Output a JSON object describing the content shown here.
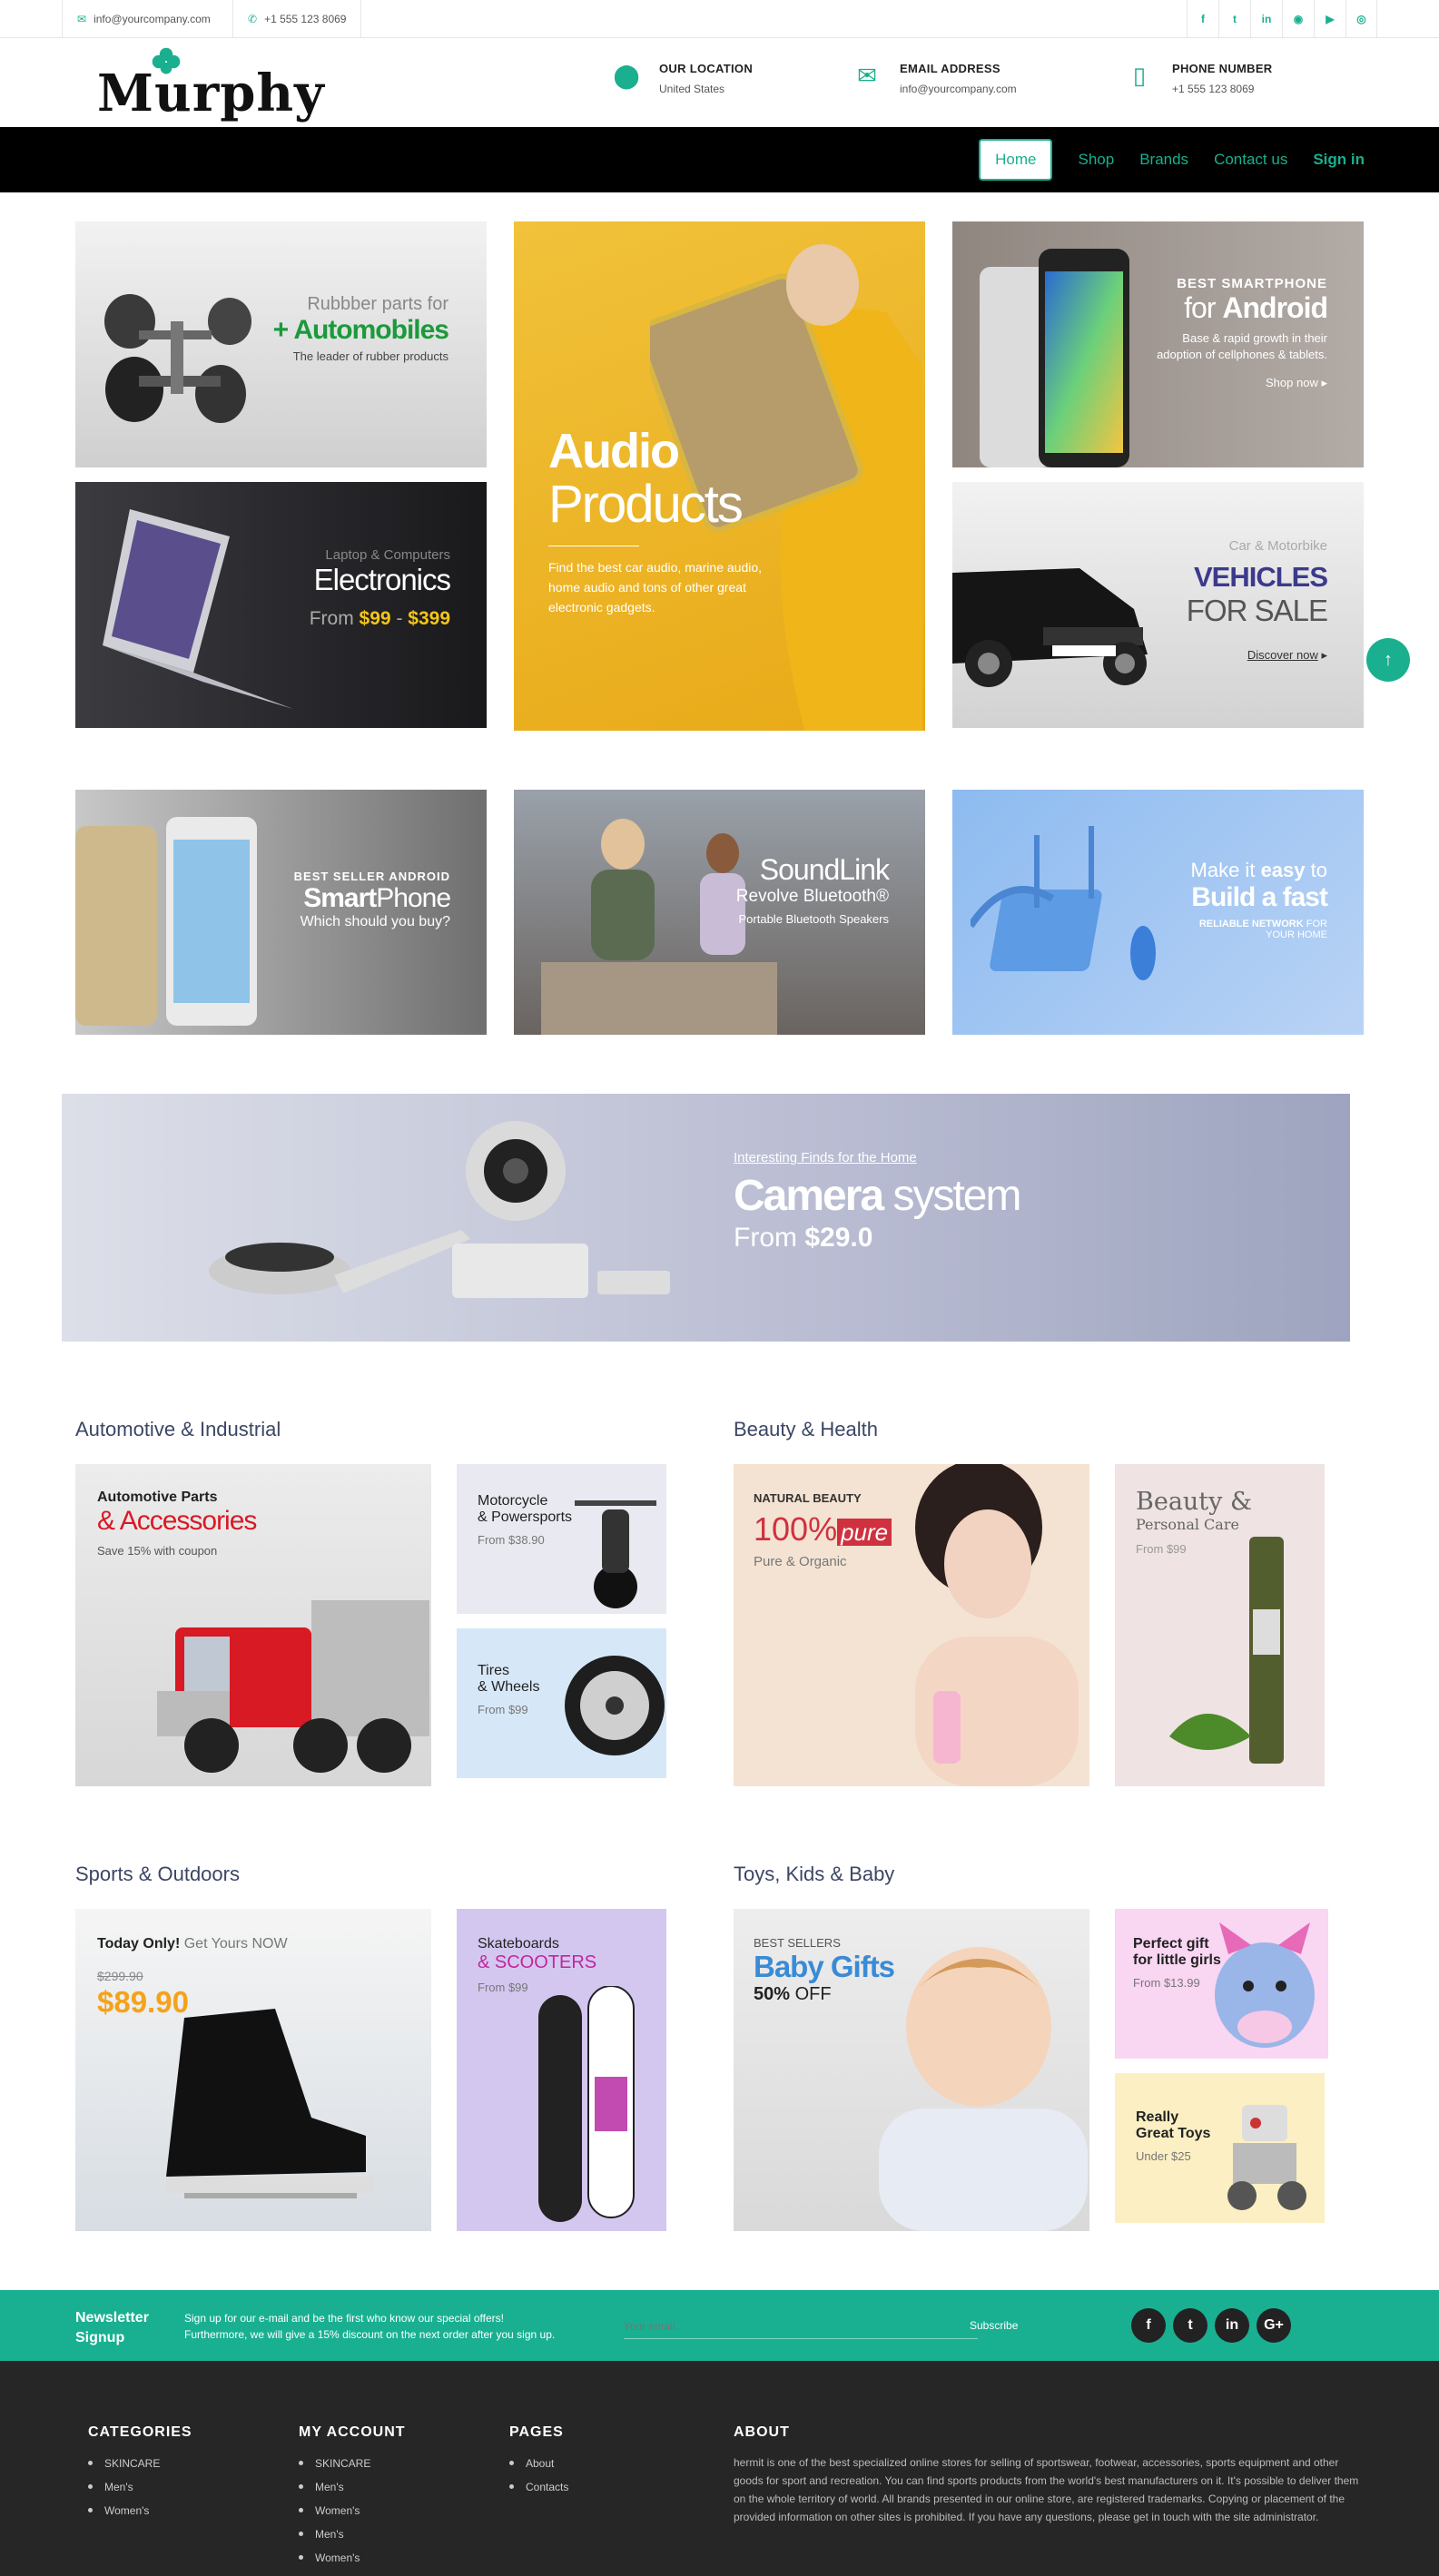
{
  "topbar": {
    "email": "info@yourcompany.com",
    "phone": "+1 555 123 8069",
    "social_icons": [
      "facebook-icon",
      "twitter-icon",
      "linkedin-icon",
      "rss-icon",
      "youtube-icon",
      "instagram-icon"
    ]
  },
  "header": {
    "logo": "Murphy",
    "location_title": "OUR LOCATION",
    "location_value": "United States",
    "email_title": "EMAIL ADDRESS",
    "email_value": "info@yourcompany.com",
    "phone_title": "PHONE NUMBER",
    "phone_value": "+1 555 123 8069"
  },
  "nav": {
    "home": "Home",
    "shop": "Shop",
    "brands": "Brands",
    "contact": "Contact us",
    "signin": "Sign in"
  },
  "banners": {
    "auto": {
      "l1": "Rubbber parts for",
      "l2": "+ Automobiles",
      "l3": "The leader of rubber products"
    },
    "audio": {
      "l1": "Audio",
      "l2": "Products",
      "l3": "Find the best car audio, marine audio, home audio and tons of other great electronic gadgets."
    },
    "android": {
      "l1": "BEST SMARTPHONE",
      "l2a": "for",
      "l2b": "Android",
      "l3": "Base & rapid growth in their adoption of cellphones & tablets.",
      "cta": "Shop now"
    },
    "electronics": {
      "l1": "Laptop & Computers",
      "l2": "Electronics",
      "l3a": "From",
      "l3b": "$99",
      "l3c": "-",
      "l3d": "$399"
    },
    "vehicles": {
      "l1": "Car & Motorbike",
      "l2": "VEHICLES",
      "l3": "FOR SALE",
      "cta": "Discover now"
    },
    "smartphone": {
      "l1": "BEST SELLER ANDROID",
      "l2a": "Smart",
      "l2b": "Phone",
      "l3": "Which should you buy?"
    },
    "soundlink": {
      "l1": "SoundLink",
      "l2": "Revolve Bluetooth®",
      "l3": "Portable Bluetooth Speakers"
    },
    "network": {
      "l1a": "Make it",
      "l1b": "easy",
      "l1c": "to",
      "l2": "Build a fast",
      "l3a": "RELIABLE NETWORK",
      "l3b": "FOR",
      "l3c": "YOUR HOME"
    },
    "camera": {
      "l1": "Interesting Finds for the Home",
      "l2a": "Camera",
      "l2b": "system",
      "l3a": "From",
      "l3b": "$29.0"
    }
  },
  "sections": {
    "automotive": {
      "title": "Automotive & Industrial",
      "main": {
        "l1": "Automotive Parts",
        "l2": "& Accessories",
        "l3": "Save 15% with coupon"
      },
      "moto": {
        "l1": "Motorcycle",
        "l2": "& Powersports",
        "l3": "From $38.90"
      },
      "tires": {
        "l1": "Tires",
        "l2": "& Wheels",
        "l3": "From $99"
      }
    },
    "beauty": {
      "title": "Beauty & Health",
      "main": {
        "l1": "NATURAL BEAUTY",
        "l2": "100%",
        "l2b": "pure",
        "l3": "Pure & Organic"
      },
      "side": {
        "l1": "Beauty &",
        "l2": "Personal Care",
        "l3": "From $99"
      }
    },
    "sports": {
      "title": "Sports & Outdoors",
      "main": {
        "l1a": "Today Only!",
        "l1b": "Get Yours NOW",
        "old": "$299.90",
        "price": "$89.90"
      },
      "side": {
        "l1": "Skateboards",
        "l2": "& SCOOTERS",
        "l3": "From $99"
      }
    },
    "toys": {
      "title": "Toys, Kids & Baby",
      "main": {
        "l1": "BEST SELLERS",
        "l2": "Baby Gifts",
        "l3a": "50%",
        "l3b": "OFF"
      },
      "gift": {
        "l1": "Perfect gift",
        "l2": "for little girls",
        "l3": "From $13.99"
      },
      "great": {
        "l1": "Really",
        "l2": "Great Toys",
        "l3": "Under $25"
      }
    }
  },
  "newsletter": {
    "title1": "Newsletter",
    "title2": "Signup",
    "desc1": "Sign up for our e-mail and be the first who know our special offers!",
    "desc2": "Furthermore, we will give a 15% discount on the next order after you sign up.",
    "placeholder": "Your email...",
    "button": "Subscribe"
  },
  "footer": {
    "categories": {
      "title": "CATEGORIES",
      "items": [
        "SKINCARE",
        "Men's",
        "Women's"
      ]
    },
    "account": {
      "title": "MY ACCOUNT",
      "items": [
        "SKINCARE",
        "Men's",
        "Women's",
        "Men's",
        "Women's"
      ]
    },
    "pages": {
      "title": "PAGES",
      "items": [
        "About",
        "Contacts"
      ]
    },
    "about": {
      "title": "ABOUT",
      "text": "hermit is one of the best specialized online stores for selling of sportswear, footwear, accessories, sports equipment and other goods for sport and recreation. You can find sports products from the world's best manufacturers on it. It's possible to deliver them on the whole territory of world. All brands presented in our online store, are registered trademarks. Copying or placement of the provided information on other sites is prohibited. If you have any questions, please get in touch with the site administrator."
    }
  },
  "colors": {
    "accent": "#1aaf8f",
    "dark": "#262626",
    "navbar": "#000000"
  }
}
